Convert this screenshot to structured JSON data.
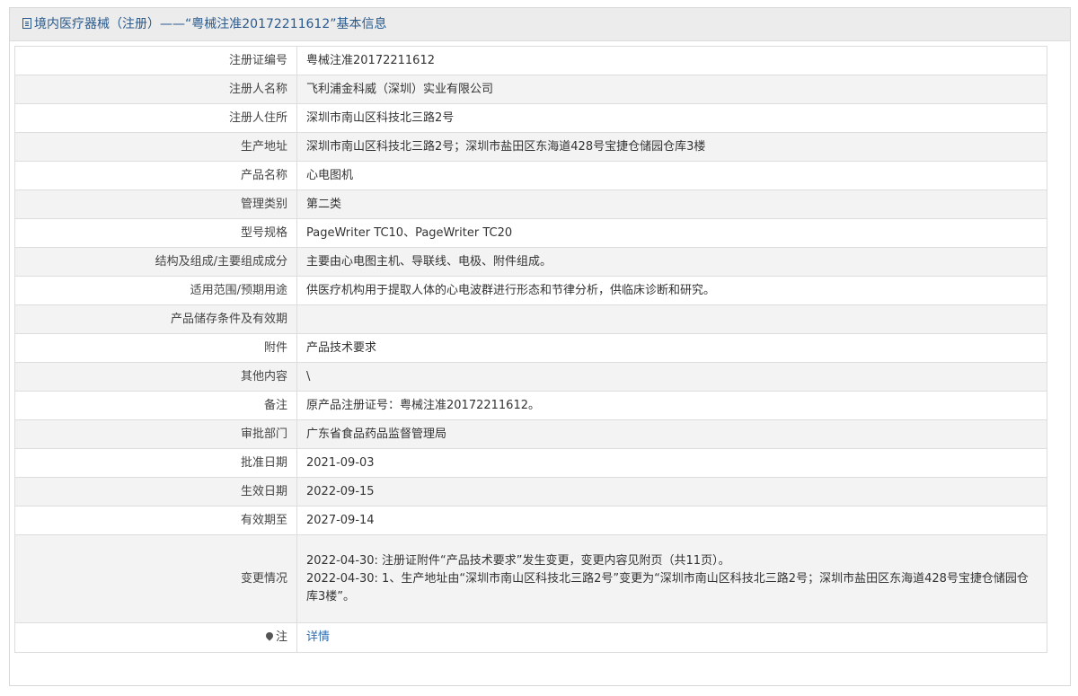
{
  "header": {
    "title": "境内医疗器械（注册）——“粤械注准20172211612”基本信息",
    "icon": "document-icon"
  },
  "rows": [
    {
      "label": "注册证编号",
      "value": "粤械注准20172211612"
    },
    {
      "label": "注册人名称",
      "value": "飞利浦金科威（深圳）实业有限公司"
    },
    {
      "label": "注册人住所",
      "value": "深圳市南山区科技北三路2号"
    },
    {
      "label": "生产地址",
      "value": "深圳市南山区科技北三路2号；深圳市盐田区东海道428号宝捷仓储园仓库3楼"
    },
    {
      "label": "产品名称",
      "value": "心电图机"
    },
    {
      "label": "管理类别",
      "value": "第二类"
    },
    {
      "label": "型号规格",
      "value": "PageWriter TC10、PageWriter TC20"
    },
    {
      "label": "结构及组成/主要组成成分",
      "value": "主要由心电图主机、导联线、电极、附件组成。"
    },
    {
      "label": "适用范围/预期用途",
      "value": "供医疗机构用于提取人体的心电波群进行形态和节律分析，供临床诊断和研究。"
    },
    {
      "label": "产品储存条件及有效期",
      "value": ""
    },
    {
      "label": "附件",
      "value": "产品技术要求"
    },
    {
      "label": "其他内容",
      "value": "\\"
    },
    {
      "label": "备注",
      "value": "原产品注册证号：粤械注准20172211612。"
    },
    {
      "label": "审批部门",
      "value": "广东省食品药品监督管理局"
    },
    {
      "label": "批准日期",
      "value": "2021-09-03"
    },
    {
      "label": "生效日期",
      "value": "2022-09-15"
    },
    {
      "label": "有效期至",
      "value": "2027-09-14"
    }
  ],
  "changes": {
    "label": "变更情况",
    "lines": [
      "2022-04-30: 注册证附件“产品技术要求”发生变更，变更内容见附页（共11页）。",
      "2022-04-30: 1、生产地址由“深圳市南山区科技北三路2号”变更为“深圳市南山区科技北三路2号；深圳市盐田区东海道428号宝捷仓储园仓库3楼”。"
    ]
  },
  "note": {
    "label": "注",
    "icon": "pin-icon",
    "link_text": "详情"
  }
}
